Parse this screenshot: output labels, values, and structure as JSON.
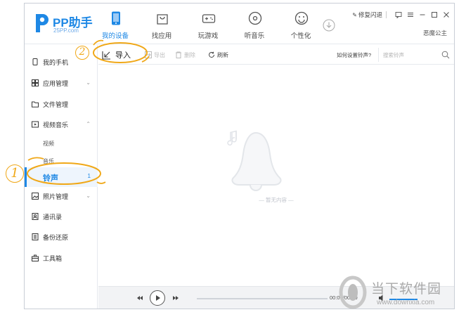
{
  "app": {
    "logo_title": "PP助手",
    "logo_sub": "25PP.com"
  },
  "nav": [
    {
      "label": "我的设备",
      "icon": "phone-icon",
      "active": true
    },
    {
      "label": "找应用",
      "icon": "bag-icon",
      "active": false
    },
    {
      "label": "玩游戏",
      "icon": "gamepad-icon",
      "active": false
    },
    {
      "label": "听音乐",
      "icon": "music-disc-icon",
      "active": false
    },
    {
      "label": "个性化",
      "icon": "smile-icon",
      "active": false
    }
  ],
  "topbar": {
    "repair_label": "修复闪退",
    "user_name": "恶魔公主"
  },
  "sidebar": {
    "items": [
      {
        "label": "我的手机",
        "icon": "phone-icon"
      },
      {
        "label": "应用管理",
        "icon": "grid-icon",
        "chevron": "⌄"
      },
      {
        "label": "文件管理",
        "icon": "folder-icon"
      },
      {
        "label": "视频音乐",
        "icon": "media-icon",
        "chevron": "⌃"
      },
      {
        "label": "照片管理",
        "icon": "image-icon",
        "chevron": "⌄"
      },
      {
        "label": "通讯录",
        "icon": "contacts-icon"
      },
      {
        "label": "备份还原",
        "icon": "backup-icon"
      },
      {
        "label": "工具箱",
        "icon": "toolbox-icon"
      }
    ],
    "sub_items": [
      "视频",
      "音乐"
    ],
    "active": {
      "label": "铃声",
      "count": "1"
    }
  },
  "toolbar": {
    "import_label": "导入",
    "export_label": "导出",
    "delete_label": "删除",
    "refresh_label": "刷新",
    "help_link": "如何设置铃声?",
    "search_placeholder": "搜索铃声"
  },
  "content": {
    "empty_text": "— 暂无内容 —"
  },
  "player": {
    "time": "00:00/00:00"
  },
  "annotations": {
    "step1": "1",
    "step2": "2"
  },
  "watermark": {
    "cn": "当下软件园",
    "url": "www.downxia.com"
  },
  "colors": {
    "accent": "#1e88e5",
    "annotation": "#f0a818"
  }
}
